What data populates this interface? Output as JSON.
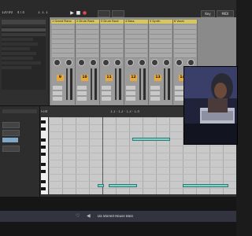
{
  "transport": {
    "bpm": "120.00",
    "time_sig": "4 / 4",
    "position": "1.  1.  1",
    "key_label": "Key",
    "midi_label": "MIDI"
  },
  "mixer": {
    "tracks": [
      {
        "name": "1 Grand Piano",
        "number": "9"
      },
      {
        "name": "2 Drum Rack",
        "number": "10"
      },
      {
        "name": "3 Drum Rack",
        "number": "11"
      },
      {
        "name": "4 Bass",
        "number": "12"
      },
      {
        "name": "5 Synth",
        "number": "13"
      },
      {
        "name": "6 Vocal",
        "number": "14"
      }
    ]
  },
  "clip": {
    "fold_label": "Fold",
    "ruler": "1.1  ·  1.2  ·  1.3  ·  1.4"
  },
  "footer": {
    "clip_name": "Da Stoned House Bass"
  },
  "colors": {
    "accent": "#7fd3c9",
    "track": "#d8c85a",
    "number": "#e8a83a"
  }
}
